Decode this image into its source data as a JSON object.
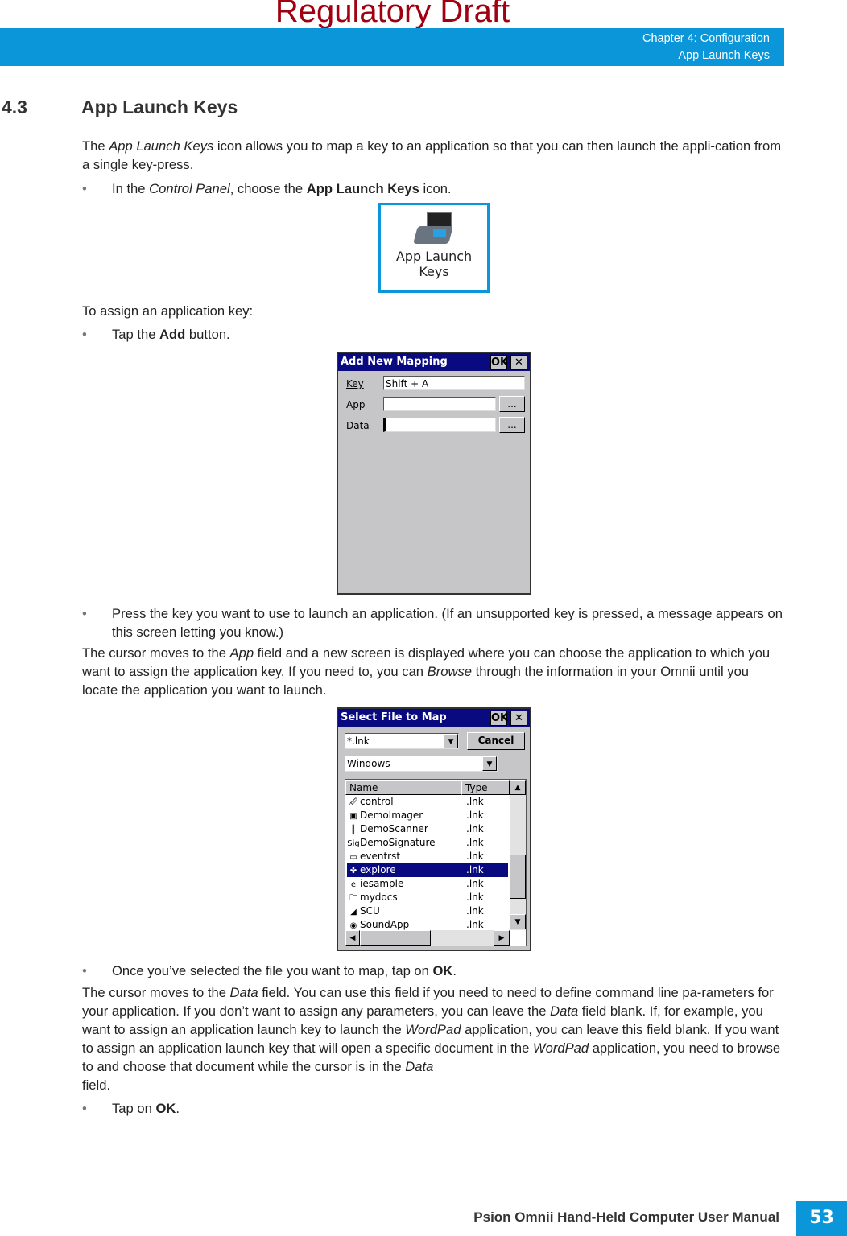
{
  "header": {
    "draft": "Regulatory Draft",
    "chapter": "Chapter 4: Configuration",
    "section": "App Launch Keys"
  },
  "section": {
    "number": "4.3",
    "title": "App Launch Keys"
  },
  "body": {
    "p1": [
      "The ",
      "App Launch Keys",
      " icon allows you to map a key to an application so that you can then launch the appli-cation from a single key-press."
    ],
    "b1": [
      "In the ",
      "Control Panel",
      ", choose the ",
      "App Launch Keys",
      " icon."
    ],
    "p2": "To assign an application key:",
    "b2": [
      "Tap the ",
      "Add",
      " button."
    ],
    "b3": "Press the key you want to use to launch an application. (If an unsupported key is pressed, a message appears on this screen letting you know.)",
    "p3": [
      "The cursor moves to the ",
      "App",
      " field and a new screen is displayed where you can choose the application to which you want to assign the application key. If you need to, you can ",
      "Browse",
      " through the information in your Omnii until you locate the application you want to launch."
    ],
    "b4": [
      "Once you’ve selected the file you want to map, tap on ",
      "OK",
      "."
    ],
    "p4": [
      "The cursor moves to the ",
      "Data",
      " field. You can use this field if you need to need to define command line pa-rameters for your application. If you don’t want to assign any parameters, you can leave the ",
      "Data",
      " field blank. If, for example, you want to assign an application launch key to launch the ",
      "WordPad",
      " application, you can leave this field blank. If you want to assign an application launch key that will open a specific document in the ",
      "WordPad",
      " application, you need to browse to and choose that document while the cursor is in the ",
      "Data",
      "\nfield."
    ],
    "b5": [
      "Tap on ",
      "OK",
      "."
    ],
    "bullet": "•"
  },
  "icon": {
    "label1": "App Launch",
    "label2": "Keys"
  },
  "dialog1": {
    "title": "Add New Mapping",
    "ok": "OK",
    "close": "✕",
    "key_label": "Key",
    "key_value": "Shift + A",
    "app_label": "App",
    "app_value": "",
    "data_label": "Data",
    "data_value": "",
    "browse": "..."
  },
  "dialog2": {
    "title": "Select File to Map",
    "ok": "OK",
    "close": "✕",
    "filter": "*.lnk",
    "cancel": "Cancel",
    "folder": "Windows",
    "col_name": "Name",
    "col_type": "Type",
    "rows": [
      {
        "name": "control",
        "type": ".lnk"
      },
      {
        "name": "DemoImager",
        "type": ".lnk"
      },
      {
        "name": "DemoScanner",
        "type": ".lnk"
      },
      {
        "name": "DemoSignature",
        "type": ".lnk"
      },
      {
        "name": "eventrst",
        "type": ".lnk"
      },
      {
        "name": "explore",
        "type": ".lnk",
        "selected": true
      },
      {
        "name": "iesample",
        "type": ".lnk"
      },
      {
        "name": "mydocs",
        "type": ".lnk"
      },
      {
        "name": "SCU",
        "type": ".lnk"
      },
      {
        "name": "SoundApp",
        "type": ".lnk"
      }
    ]
  },
  "footer": {
    "title": "Psion Omnii Hand-Held Computer User Manual",
    "page": "53"
  }
}
